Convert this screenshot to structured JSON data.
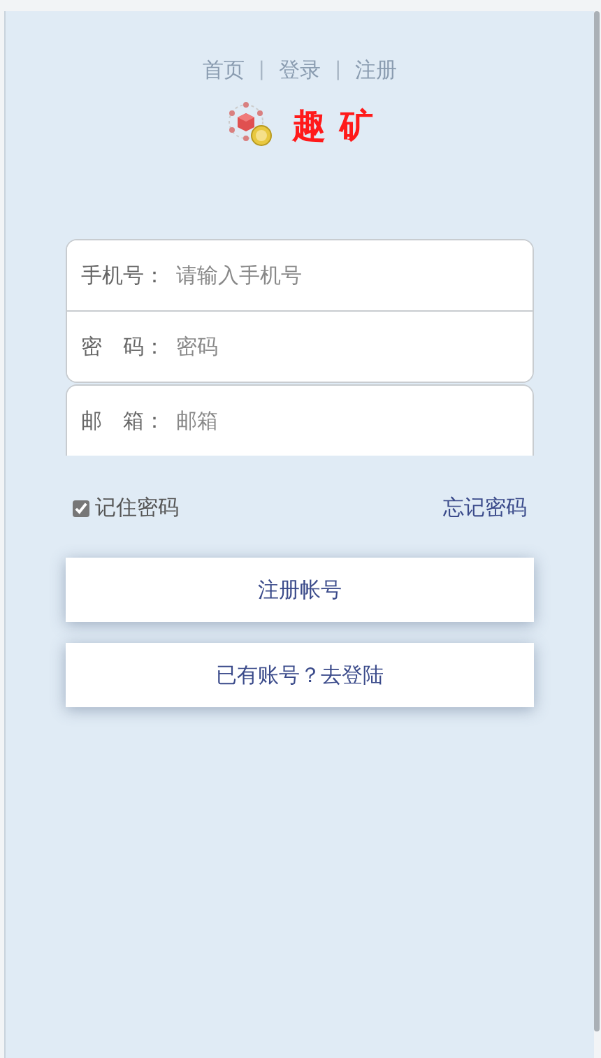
{
  "nav": [
    {
      "kind": "link",
      "text": "首页"
    },
    {
      "kind": "separator",
      "text": "|"
    },
    {
      "kind": "link",
      "text": "登录"
    },
    {
      "kind": "separator",
      "text": "|"
    },
    {
      "kind": "link",
      "text": "注册"
    }
  ],
  "logo": {
    "text": "趣 矿"
  },
  "field_groups": [
    {
      "fields": [
        {
          "label": "手机号：",
          "placeholder": "请输入手机号"
        },
        {
          "label": "密　码：",
          "placeholder": "密码"
        }
      ]
    },
    {
      "fields": [
        {
          "label": "邮　箱：",
          "placeholder": "邮箱"
        }
      ]
    }
  ],
  "remember": {
    "label": "记住密码",
    "checked": true
  },
  "forgot_link": "忘记密码",
  "buttons": [
    "注册帐号",
    "已有账号？去登陆"
  ]
}
